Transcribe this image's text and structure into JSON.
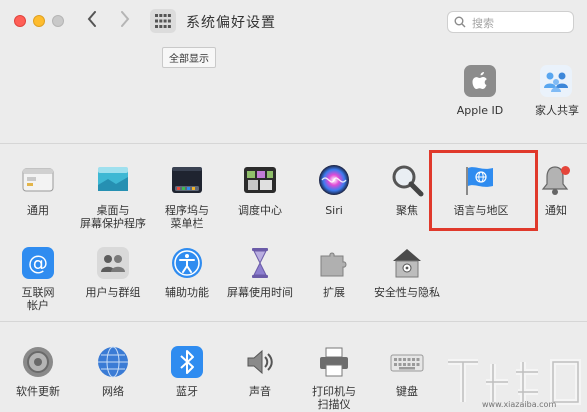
{
  "window": {
    "title": "系统偏好设置"
  },
  "search": {
    "placeholder": "搜索"
  },
  "tooltip": {
    "text": "全部显示"
  },
  "account": [
    {
      "label": "Apple ID",
      "icon": "apple-id-icon"
    },
    {
      "label": "家人共享",
      "icon": "family-sharing-icon"
    }
  ],
  "row1": [
    {
      "label": "通用",
      "icon": "general-icon"
    },
    {
      "label": "桌面与\n屏幕保护程序",
      "label1": "桌面与",
      "label2": "屏幕保护程序",
      "icon": "desktop-icon"
    },
    {
      "label1": "程序坞与",
      "label2": "菜单栏",
      "icon": "dock-icon"
    },
    {
      "label": "调度中心",
      "icon": "mission-control-icon"
    },
    {
      "label": "Siri",
      "icon": "siri-icon"
    },
    {
      "label": "聚焦",
      "icon": "spotlight-icon"
    },
    {
      "label": "语言与地区",
      "icon": "language-region-icon"
    },
    {
      "label": "通知",
      "icon": "notifications-icon"
    }
  ],
  "row2": [
    {
      "label1": "互联网",
      "label2": "帐户",
      "icon": "internet-accounts-icon"
    },
    {
      "label": "用户与群组",
      "icon": "users-groups-icon"
    },
    {
      "label": "辅助功能",
      "icon": "accessibility-icon"
    },
    {
      "label": "屏幕使用时间",
      "icon": "screen-time-icon"
    },
    {
      "label": "扩展",
      "icon": "extensions-icon"
    },
    {
      "label": "安全性与隐私",
      "icon": "security-privacy-icon"
    }
  ],
  "row3": [
    {
      "label": "软件更新",
      "icon": "software-update-icon"
    },
    {
      "label": "网络",
      "icon": "network-icon"
    },
    {
      "label": "蓝牙",
      "icon": "bluetooth-icon"
    },
    {
      "label": "声音",
      "icon": "sound-icon"
    },
    {
      "label1": "打印机与",
      "label2": "扫描仪",
      "icon": "printers-icon"
    },
    {
      "label": "键盘",
      "icon": "keyboard-icon"
    }
  ],
  "colors": {
    "highlight": "#e0392b",
    "accent": "#2f8cf0"
  },
  "watermark": {
    "text": "www.xiazaiba.com"
  }
}
